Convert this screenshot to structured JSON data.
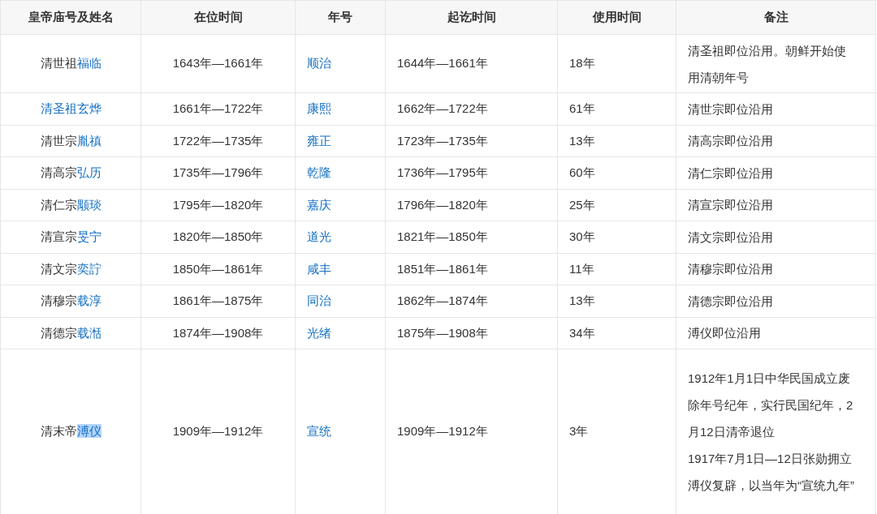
{
  "table": {
    "columns": [
      "皇帝庙号及姓名",
      "在位时间",
      "年号",
      "起讫时间",
      "使用时间",
      "备注"
    ],
    "rows": [
      {
        "emperor": [
          {
            "text": "清世祖",
            "link": false,
            "highlighted": false
          },
          {
            "text": "福临",
            "link": true,
            "highlighted": false
          }
        ],
        "reign": "1643年—1661年",
        "era": "顺治",
        "span": "1644年—1661年",
        "years": "18年",
        "remarks": [
          "清圣祖即位沿用。朝鲜开始使用清朝年号"
        ]
      },
      {
        "emperor": [
          {
            "text": "清圣祖玄烨",
            "link": true,
            "highlighted": false
          }
        ],
        "reign": "1661年—1722年",
        "era": "康熙",
        "span": "1662年—1722年",
        "years": "61年",
        "remarks": [
          "清世宗即位沿用"
        ]
      },
      {
        "emperor": [
          {
            "text": "清世宗",
            "link": false,
            "highlighted": false
          },
          {
            "text": "胤禛",
            "link": true,
            "highlighted": false
          }
        ],
        "reign": "1722年—1735年",
        "era": "雍正",
        "span": "1723年—1735年",
        "years": "13年",
        "remarks": [
          "清高宗即位沿用"
        ]
      },
      {
        "emperor": [
          {
            "text": "清高宗",
            "link": false,
            "highlighted": false
          },
          {
            "text": "弘历",
            "link": true,
            "highlighted": false
          }
        ],
        "reign": "1735年—1796年",
        "era": "乾隆",
        "span": "1736年—1795年",
        "years": "60年",
        "remarks": [
          "清仁宗即位沿用"
        ]
      },
      {
        "emperor": [
          {
            "text": "清仁宗",
            "link": false,
            "highlighted": false
          },
          {
            "text": "颙琰",
            "link": true,
            "highlighted": false
          }
        ],
        "reign": "1795年—1820年",
        "era": "嘉庆",
        "span": "1796年—1820年",
        "years": "25年",
        "remarks": [
          "清宣宗即位沿用"
        ]
      },
      {
        "emperor": [
          {
            "text": "清宣宗",
            "link": false,
            "highlighted": false
          },
          {
            "text": "旻宁",
            "link": true,
            "highlighted": false
          }
        ],
        "reign": "1820年—1850年",
        "era": "道光",
        "span": "1821年—1850年",
        "years": "30年",
        "remarks": [
          "清文宗即位沿用"
        ]
      },
      {
        "emperor": [
          {
            "text": "清文宗",
            "link": false,
            "highlighted": false
          },
          {
            "text": "奕詝",
            "link": true,
            "highlighted": false
          }
        ],
        "reign": "1850年—1861年",
        "era": "咸丰",
        "span": "1851年—1861年",
        "years": "11年",
        "remarks": [
          "清穆宗即位沿用"
        ]
      },
      {
        "emperor": [
          {
            "text": "清穆宗",
            "link": false,
            "highlighted": false
          },
          {
            "text": "载淳",
            "link": true,
            "highlighted": false
          }
        ],
        "reign": "1861年—1875年",
        "era": "同治",
        "span": "1862年—1874年",
        "years": "13年",
        "remarks": [
          "清德宗即位沿用"
        ]
      },
      {
        "emperor": [
          {
            "text": "清德宗",
            "link": false,
            "highlighted": false
          },
          {
            "text": "载湉",
            "link": true,
            "highlighted": false
          }
        ],
        "reign": "1874年—1908年",
        "era": "光绪",
        "span": "1875年—1908年",
        "years": "34年",
        "remarks": [
          "溥仪即位沿用"
        ]
      },
      {
        "emperor": [
          {
            "text": "清末帝",
            "link": false,
            "highlighted": false
          },
          {
            "text": "溥仪",
            "link": true,
            "highlighted": true
          }
        ],
        "reign": "1909年—1912年",
        "era": "宣统",
        "span": "1909年—1912年",
        "years": "3年",
        "remarks": [
          "1912年1月1日中华民国成立废除年号纪年，实行民国纪年，2月12日清帝退位",
          "1917年7月1日—12日张勋拥立溥仪复辟，以当年为“宣统九年”"
        ]
      }
    ]
  }
}
